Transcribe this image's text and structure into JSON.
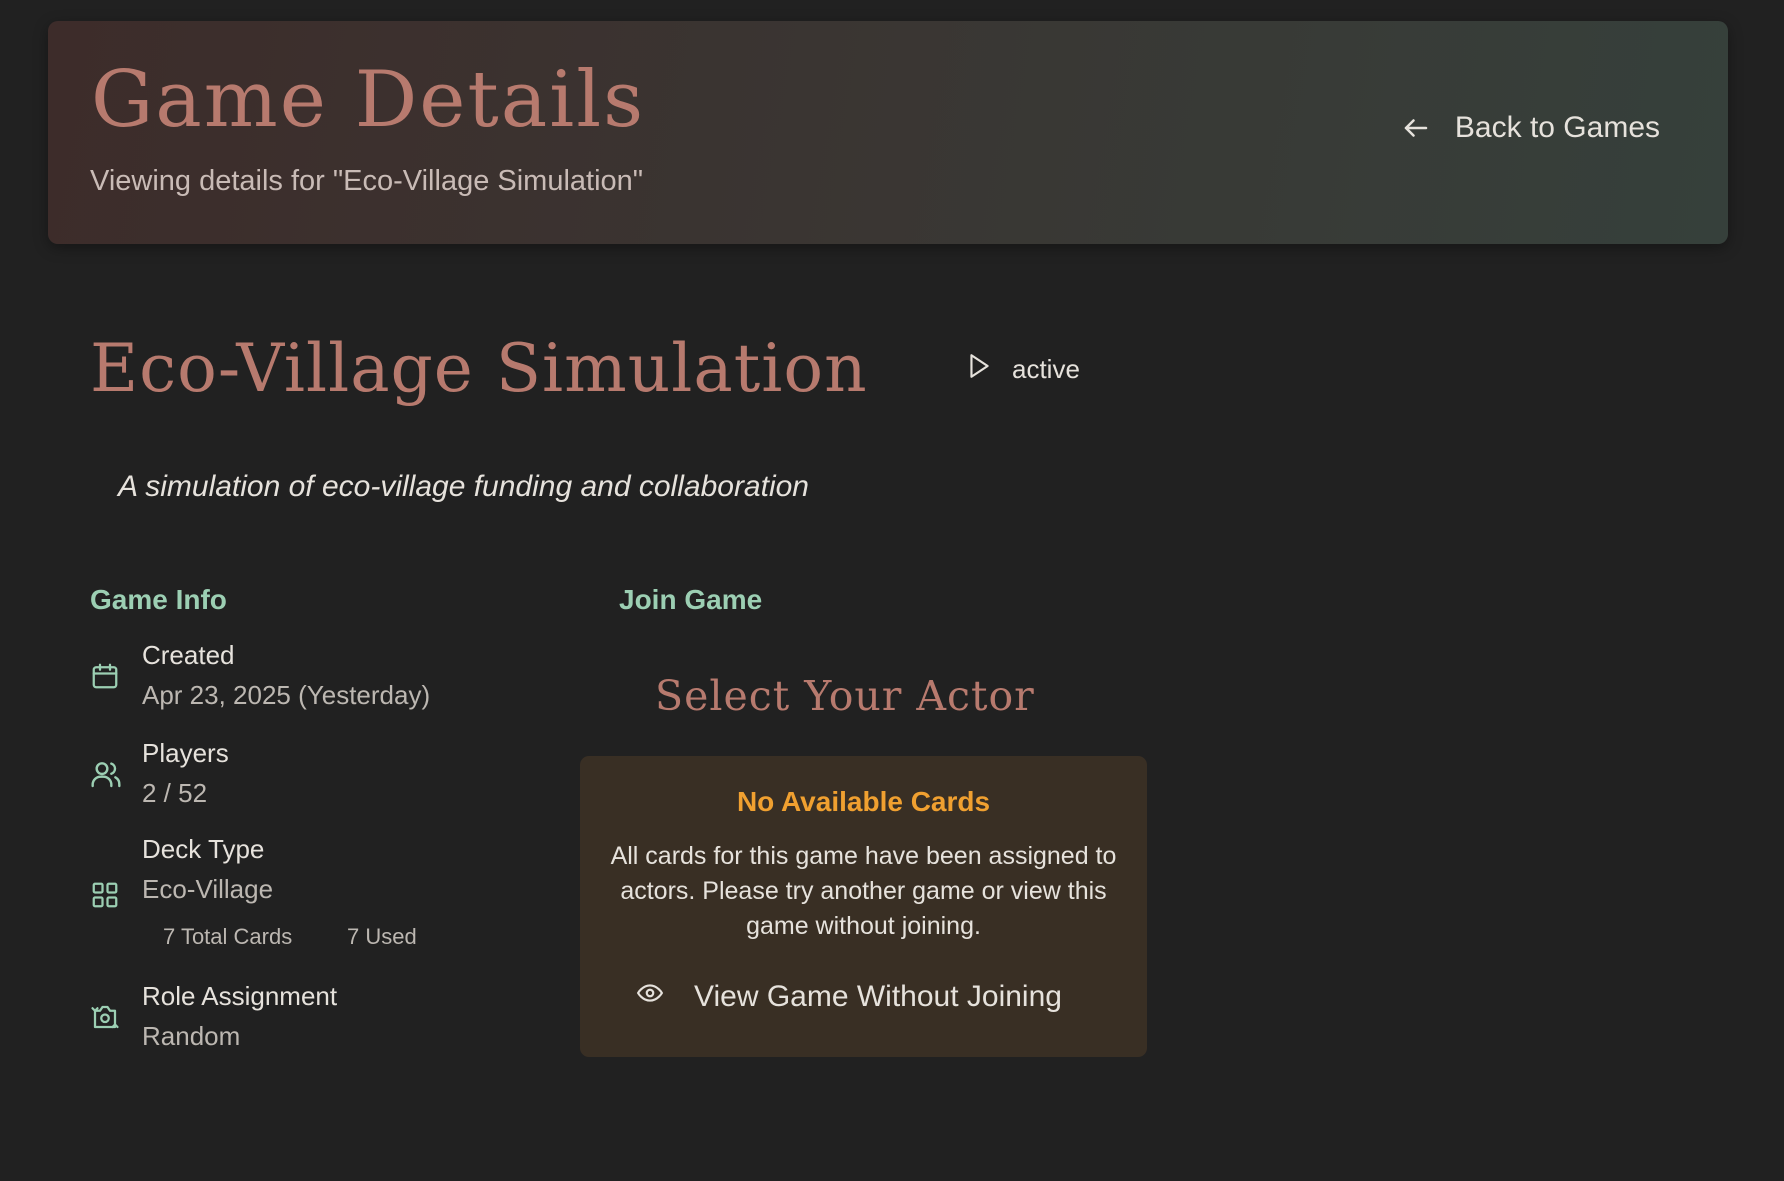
{
  "header": {
    "title": "Game Details",
    "subtitle": "Viewing details for \"Eco-Village Simulation\"",
    "back_label": "Back to Games"
  },
  "game": {
    "title": "Eco-Village Simulation",
    "status": "active",
    "description": "A simulation of eco-village funding and collaboration"
  },
  "info": {
    "heading": "Game Info",
    "created_label": "Created",
    "created_value": "Apr 23, 2025 (Yesterday)",
    "players_label": "Players",
    "players_value": "2 / 52",
    "deck_label": "Deck Type",
    "deck_value": "Eco-Village",
    "total_cards": "7 Total Cards",
    "used_cards": "7 Used",
    "role_label": "Role Assignment",
    "role_value": "Random"
  },
  "join": {
    "heading": "Join Game",
    "actor_title": "Select Your Actor",
    "no_cards_title": "No Available Cards",
    "no_cards_message": "All cards for this game have been assigned to actors. Please try another game or view this game without joining.",
    "view_button": "View Game Without Joining"
  },
  "colors": {
    "background": "#212121",
    "title_accent": "#b77a6e",
    "section_heading": "#9ccfb3",
    "warning": "#f0a030",
    "card_bg": "#392f24"
  },
  "icons": {
    "back": "arrow-left-icon",
    "status": "play-icon",
    "created": "calendar-icon",
    "players": "users-icon",
    "deck": "grid-icon",
    "role": "shuffle-camera-icon",
    "view": "eye-icon"
  }
}
